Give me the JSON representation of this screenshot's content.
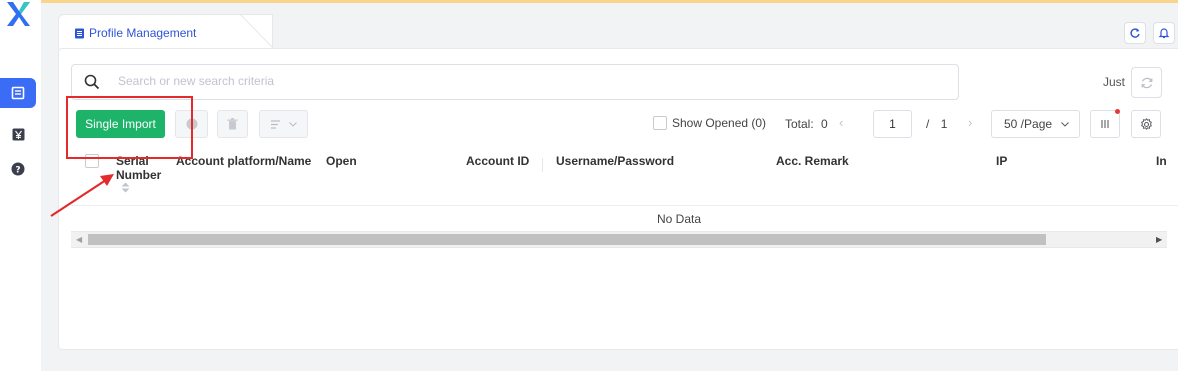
{
  "tab": {
    "label": "Profile Management",
    "icon": "document-icon"
  },
  "top_right": {
    "refresh_icon": "refresh-icon",
    "bell_icon": "bell-icon"
  },
  "search": {
    "placeholder": "Search or new search criteria",
    "value": ""
  },
  "just_label": "Just",
  "toolbar": {
    "single_import": "Single Import",
    "show_opened": "Show Opened (0)",
    "total_label": "Total:",
    "total_value": "0",
    "page_current": "1",
    "page_sep": "/",
    "page_total": "1",
    "page_size": "50 /Page"
  },
  "table": {
    "columns": [
      "Serial Number",
      "Account platform/Name",
      "Open",
      "Account ID",
      "Username/Password",
      "Acc. Remark",
      "IP",
      "In"
    ],
    "rows": [],
    "empty_text": "No Data"
  },
  "colors": {
    "accent": "#3b6cf6",
    "primary_button": "#1db46a",
    "annotation": "#e32b2b",
    "top_line": "#f9d48a"
  }
}
